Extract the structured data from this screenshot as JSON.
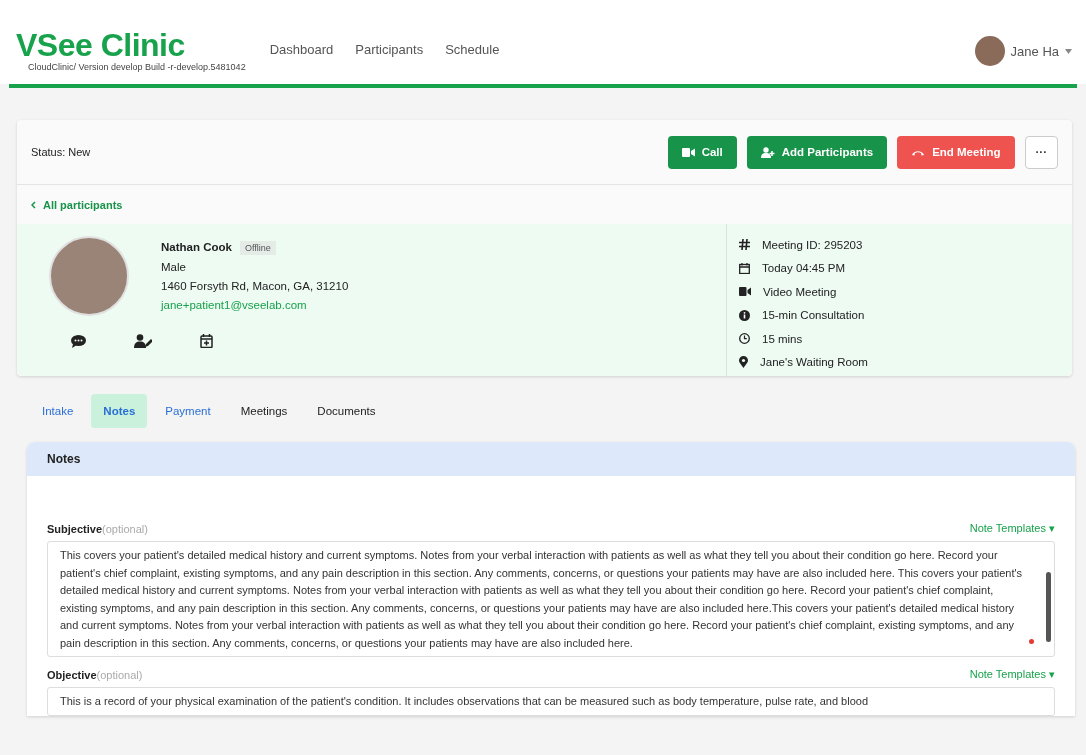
{
  "header": {
    "logo": "VSee Clinic",
    "version": "CloudClinic/ Version develop Build -r-develop.5481042",
    "nav": [
      "Dashboard",
      "Participants",
      "Schedule"
    ],
    "user": {
      "name": "Jane Ha"
    }
  },
  "toolbar": {
    "status": "Status: New",
    "buttons": [
      {
        "label": "Call",
        "kind": "call"
      },
      {
        "label": "Add Participants",
        "kind": "add"
      },
      {
        "label": "End Meeting",
        "kind": "end"
      },
      {
        "label": "···",
        "kind": "more"
      }
    ]
  },
  "back_link": "All participants",
  "patient": {
    "name": "Nathan Cook",
    "presence": "Offline",
    "gender": "Male",
    "address": "1460 Forsyth Rd, Macon, GA, 31210",
    "email": "jane+patient1@vseelab.com"
  },
  "meeting": [
    {
      "kind": "hash",
      "text": "Meeting ID: 295203"
    },
    {
      "kind": "calendar",
      "text": "Today 04:45 PM"
    },
    {
      "kind": "video",
      "text": "Video Meeting"
    },
    {
      "kind": "info",
      "text": "15-min Consultation"
    },
    {
      "kind": "clock",
      "text": "15 mins"
    },
    {
      "kind": "pin",
      "text": "Jane's Waiting Room"
    }
  ],
  "tabs": [
    {
      "label": "Intake",
      "kind": "link",
      "selected": false
    },
    {
      "label": "Notes",
      "kind": "link",
      "selected": true
    },
    {
      "label": "Payment",
      "kind": "link",
      "selected": false
    },
    {
      "label": "Meetings",
      "kind": "plain",
      "selected": false
    },
    {
      "label": "Documents",
      "kind": "plain",
      "selected": false
    }
  ],
  "notes": {
    "title": "Notes",
    "sections": [
      {
        "label": "Subjective",
        "hint": "(optional)",
        "templates": "Note Templates ▾",
        "value": "This covers your patient's detailed medical history and current symptoms. Notes from your verbal interaction with patients as well as what they tell you about their condition go here. Record your patient's chief complaint, existing symptoms, and any pain description in this section. Any comments, concerns, or questions your patients may have are also included here. This covers your patient's detailed medical history and current symptoms. Notes from your verbal interaction with patients as well as what they tell you about their condition go here. Record your patient's chief complaint, existing symptoms, and any pain description in this section. Any comments, concerns, or questions your patients may have are also included here.This covers your patient's detailed medical history and current symptoms. Notes from your verbal interaction with patients as well as what they tell you about their condition go here. Record your patient's chief complaint, existing symptoms, and any pain description in this section. Any comments, concerns, or questions your patients may have are also included here."
      },
      {
        "label": "Objective",
        "hint": "(optional)",
        "templates": "Note Templates ▾",
        "value": "This is a record of your physical examination of the patient's condition. It includes observations that can be measured such as body temperature, pulse rate, and blood"
      }
    ]
  }
}
